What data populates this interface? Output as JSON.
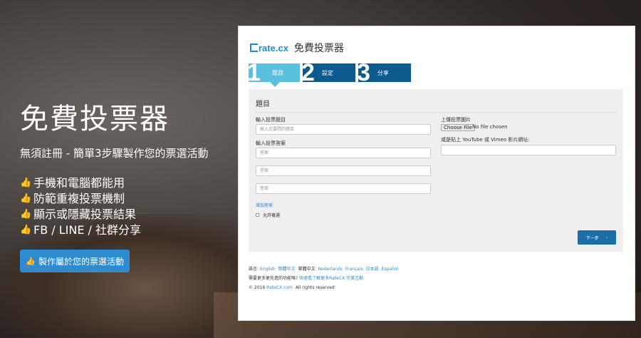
{
  "hero": {
    "title": "免費投票器",
    "subtitle": "無須註冊 - 簡單3步驟製作您的票選活動",
    "features": [
      "手機和電腦都能用",
      "防範重複投票機制",
      "顯示或隱藏投票結果",
      "FB / LINE / 社群分享"
    ],
    "cta_label": "製作屬於您的票選活動"
  },
  "app": {
    "brand_logo": "rate.cx",
    "brand_title": "免費投票器",
    "steps": [
      {
        "num": "1",
        "label": "題目"
      },
      {
        "num": "2",
        "label": "設定"
      },
      {
        "num": "3",
        "label": "分享"
      }
    ],
    "form": {
      "heading": "題目",
      "question_label": "輸入投票題目",
      "question_placeholder": "輸入您要問的題目",
      "answers_label": "輸入投票答案",
      "answer_placeholders": [
        "答案",
        "答案",
        "答案"
      ],
      "add_answer": "增加答案",
      "allow_multi": "允許複選",
      "image_label": "上傳投票圖片",
      "choose_file": "Choose File",
      "no_file": "No file chosen",
      "video_label": "或是貼上 YouTube 或 Vimeo 影片網址:",
      "next_label": "下一步"
    },
    "footer": {
      "language_label": "語言:",
      "languages": [
        "English",
        "簡體中文",
        "繁體中文",
        "Nederlands",
        "Français",
        "日本語",
        "Español"
      ],
      "help_prefix": "需要更多更先進的功能嗎?",
      "help_link": "快速看了解更多RateCX 完美互動",
      "copyright_prefix": "© 2016",
      "copyright_link": "RateCX.com",
      "copyright_suffix": "All rights reserved"
    }
  },
  "colors": {
    "accent": "#2e8bd0",
    "step_active": "#5bc0de",
    "step_inactive": "#0d5a8e"
  },
  "icons": {
    "feature": "thumbs-up-icon",
    "cta": "thumbs-up-icon",
    "next": "chevron-right-icon"
  }
}
